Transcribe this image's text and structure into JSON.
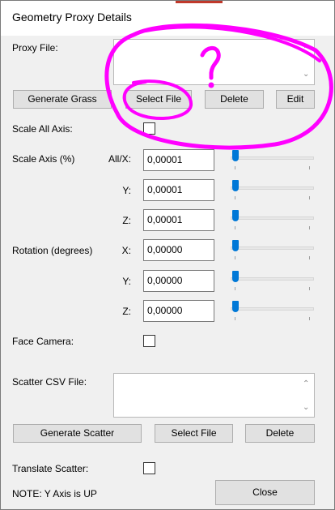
{
  "window": {
    "title": "Geometry Proxy Details"
  },
  "proxy_file": {
    "label": "Proxy File:",
    "value": "",
    "buttons": {
      "generate": "Generate Grass",
      "select": "Select File",
      "delete": "Delete",
      "edit": "Edit"
    }
  },
  "scale_all": {
    "label": "Scale All Axis:",
    "checked": false
  },
  "scale_axis": {
    "label": "Scale Axis (%)",
    "axes": [
      {
        "label": "All/X:",
        "value": "0,00001"
      },
      {
        "label": "Y:",
        "value": "0,00001"
      },
      {
        "label": "Z:",
        "value": "0,00001"
      }
    ]
  },
  "rotation": {
    "label": "Rotation (degrees)",
    "axes": [
      {
        "label": "X:",
        "value": "0,00000"
      },
      {
        "label": "Y:",
        "value": "0,00000"
      },
      {
        "label": "Z:",
        "value": "0,00000"
      }
    ]
  },
  "face_camera": {
    "label": "Face Camera:",
    "checked": false
  },
  "scatter": {
    "label": "Scatter CSV File:",
    "value": "",
    "buttons": {
      "generate": "Generate Scatter",
      "select": "Select File",
      "delete": "Delete"
    }
  },
  "translate_scatter": {
    "label": "Translate Scatter:",
    "checked": false
  },
  "note": "NOTE: Y Axis is UP",
  "close_label": "Close",
  "colors": {
    "accent": "#0078d7",
    "annotation": "#ff00ff",
    "title_strip": "#c0392b"
  }
}
